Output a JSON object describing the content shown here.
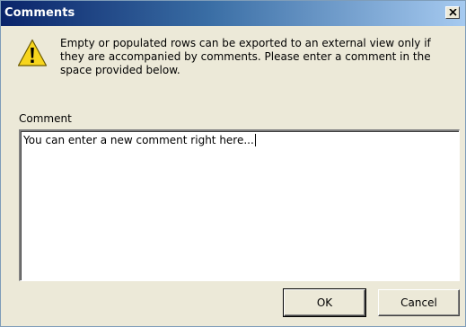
{
  "window": {
    "title": "Comments"
  },
  "dialog": {
    "icon": "warning-icon",
    "message": "Empty or populated rows can be exported to an external view only if they are accompanied by comments. Please enter a comment in the space provided below."
  },
  "comment": {
    "label": "Comment",
    "value": "You can enter a new comment right here..."
  },
  "buttons": {
    "ok_label": "OK",
    "cancel_label": "Cancel"
  },
  "colors": {
    "titlebar_start": "#0a246a",
    "titlebar_end": "#a6caf0",
    "dialog_background": "#ece9d8",
    "warning_yellow": "#f7d51d"
  }
}
